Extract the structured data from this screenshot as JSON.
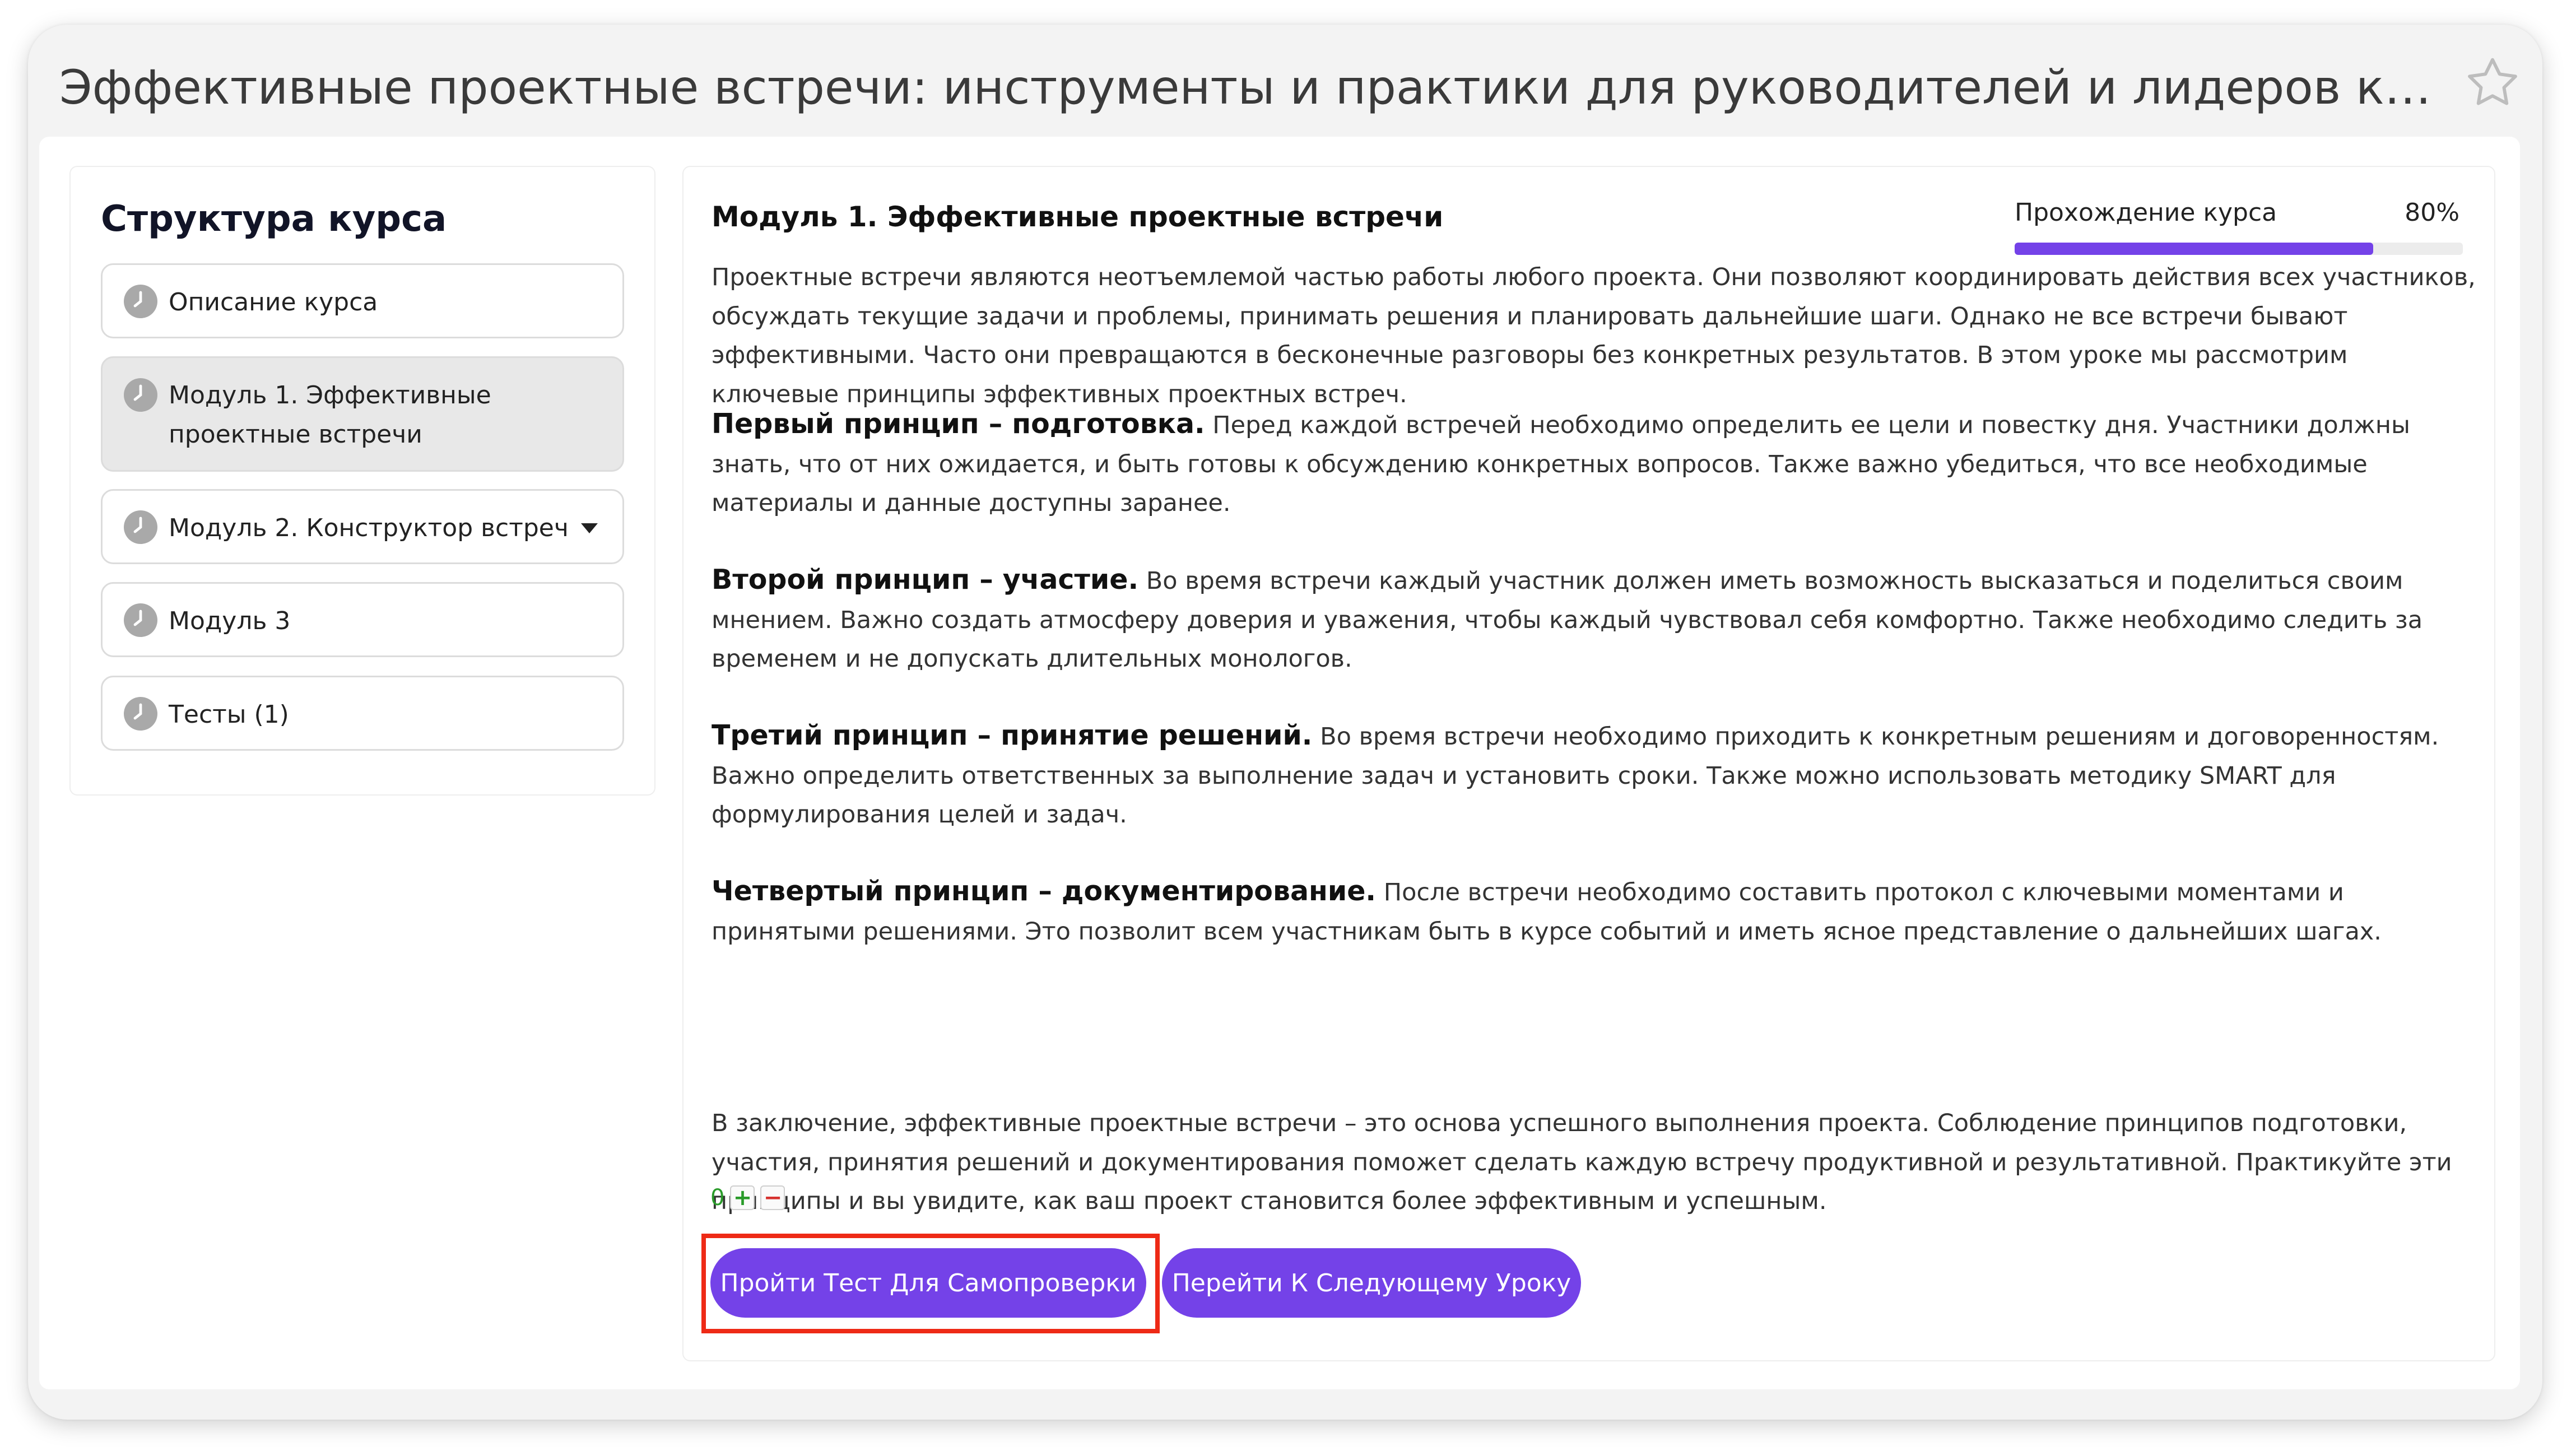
{
  "header": {
    "title": "Эффективные проектные встречи: инструменты и практики для руководителей и лидеров команд",
    "star_icon": "star-outline-icon"
  },
  "sidebar": {
    "title": "Структура курса",
    "items": [
      {
        "label": "Описание курса",
        "icon": "clock-icon"
      },
      {
        "label": "Модуль 1. Эффективные проектные встречи",
        "icon": "clock-icon",
        "active": true
      },
      {
        "label": "Модуль 2. Конструктор встреч",
        "icon": "clock-icon",
        "has_dropdown": true
      },
      {
        "label": "Модуль 3",
        "icon": "clock-icon"
      },
      {
        "label": "Тесты (1)",
        "icon": "clock-icon"
      }
    ]
  },
  "main": {
    "module_title": "Модуль 1. Эффективные проектные встречи",
    "progress": {
      "label": "Прохождение курса",
      "value_text": "80%",
      "value": 0.8
    },
    "paragraphs": [
      {
        "bold": "",
        "text": "Проектные встречи являются неотъемлемой частью работы любого проекта. Они позволяют координировать действия всех участников, обсуждать текущие задачи и проблемы, принимать решения и планировать дальнейшие шаги. Однако не все встречи бывают эффективными. Часто они превращаются в бесконечные разговоры без конкретных результатов. В этом уроке мы рассмотрим ключевые принципы эффективных проектных встреч."
      },
      {
        "bold": "Первый принцип – подготовка.",
        "text": " Перед каждой встречей необходимо определить ее цели и повестку дня. Участники должны знать, что от них ожидается, и быть готовы к обсуждению конкретных вопросов. Также важно убедиться, что все необходимые материалы и данные доступны заранее."
      },
      {
        "bold": "Второй принцип – участие.",
        "text": " Во время встречи каждый участник должен иметь возможность высказаться и поделиться своим мнением. Важно создать атмосферу доверия и уважения, чтобы каждый чувствовал себя комфортно. Также необходимо следить за временем и не допускать длительных монологов."
      },
      {
        "bold": "Третий принцип – принятие решений.",
        "text": " Во время встречи необходимо приходить к конкретным решениям и договоренностям. Важно определить ответственных за выполнение задач и установить сроки. Также можно использовать методику SMART для формулирования целей и задач."
      },
      {
        "bold": "Четвертый принцип – документирование.",
        "text": " После встречи необходимо составить протокол с ключевыми моментами и принятыми решениями. Это позволит всем участникам быть в курсе событий и иметь ясное представление о дальнейших шагах."
      },
      {
        "bold": "",
        "text": "В заключение, эффективные проектные встречи – это основа успешного выполнения проекта. Соблюдение принципов подготовки, участия, принятия решений и документирования поможет сделать каждую встречу продуктивной и результативной. Практикуйте эти принципы и вы увидите, как ваш проект становится более эффективным и успешным."
      }
    ],
    "rating": {
      "count": "0",
      "plus": "+",
      "minus": "−"
    },
    "buttons": {
      "self_test": "Пройти Тест Для Самопроверки",
      "next_lesson": "Перейти К Следующему Уроку"
    }
  },
  "colors": {
    "accent": "#7442e8",
    "highlight": "#ee2a16",
    "rating_positive": "#2a9b2a",
    "rating_negative": "#d6322f"
  }
}
